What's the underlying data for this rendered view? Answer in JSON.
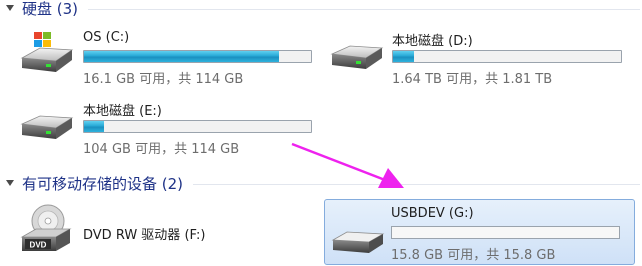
{
  "hard_disks": {
    "header": "硬盘 (3)",
    "drives": [
      {
        "name": "OS (C:)",
        "info": "16.1 GB 可用，共 114 GB",
        "used_fraction": 0.86
      },
      {
        "name": "本地磁盘 (D:)",
        "info": "1.64 TB 可用，共 1.81 TB",
        "used_fraction": 0.09
      },
      {
        "name": "本地磁盘 (E:)",
        "info": "104 GB 可用，共 114 GB",
        "used_fraction": 0.09
      }
    ]
  },
  "removable": {
    "header": "有可移动存储的设备 (2)",
    "dvd": {
      "name": "DVD RW 驱动器 (F:)",
      "badge": "DVD"
    },
    "usb": {
      "name": "USBDEV (G:)",
      "info": "15.8 GB 可用，共 15.8 GB",
      "used_fraction": 0.0
    }
  },
  "colors": {
    "header_text": "#1e3287",
    "bar_fill": "#27a8d6",
    "selection_bg": "#d9e8f9",
    "annotation_arrow": "#ee22ee"
  }
}
